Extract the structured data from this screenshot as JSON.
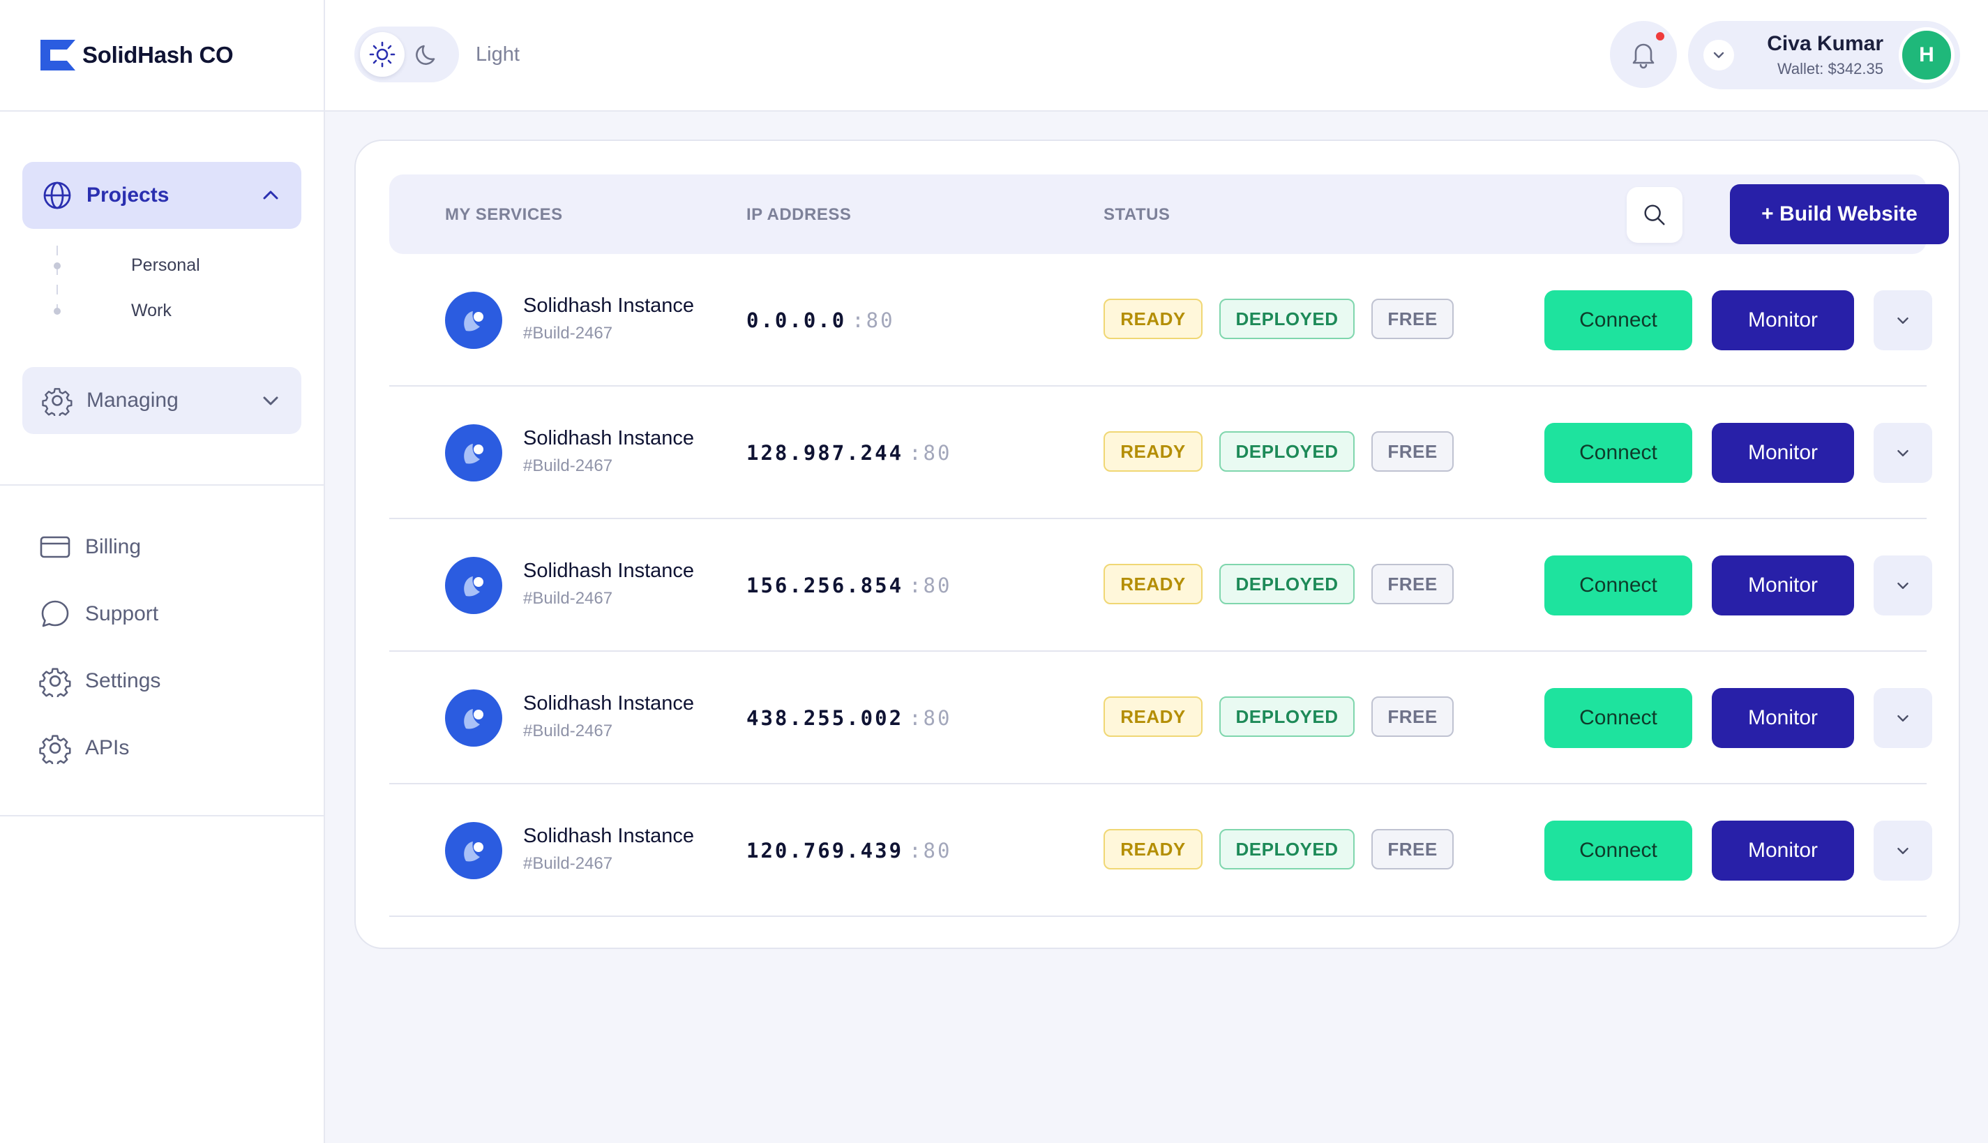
{
  "brand": {
    "name": "SolidHash CO"
  },
  "colors": {
    "primary": "#2820a8",
    "accent_green": "#1ee39e",
    "service_icon": "#2b5ce0",
    "notification_dot": "#ef3b3b",
    "avatar": "#1fb87a"
  },
  "sidebar": {
    "projects": {
      "label": "Projects",
      "icon": "globe-icon",
      "expanded": true,
      "children": [
        {
          "label": "Personal"
        },
        {
          "label": "Work"
        }
      ]
    },
    "managing": {
      "label": "Managing",
      "icon": "gear-icon",
      "expanded": false
    },
    "menu": [
      {
        "label": "Billing",
        "icon": "credit-card-icon"
      },
      {
        "label": "Support",
        "icon": "chat-bubble-icon"
      },
      {
        "label": "Settings",
        "icon": "gear-icon"
      },
      {
        "label": "APIs",
        "icon": "gear-icon"
      }
    ]
  },
  "topbar": {
    "theme_label": "Light",
    "theme_selected": "light",
    "has_notification": true,
    "user": {
      "name": "Civa Kumar",
      "wallet": "Wallet: $342.35",
      "avatar_initial": "H"
    }
  },
  "services": {
    "headers": {
      "service": "MY SERVICES",
      "ip": "IP ADDRESS",
      "status": "STATUS"
    },
    "build_button": "+ Build Website",
    "connect_label": "Connect",
    "monitor_label": "Monitor",
    "rows": [
      {
        "name": "Solidhash Instance",
        "build": "#Build-2467",
        "ip": "0.0.0.0",
        "port": ":80",
        "badges": [
          "READY",
          "DEPLOYED",
          "FREE"
        ]
      },
      {
        "name": "Solidhash Instance",
        "build": "#Build-2467",
        "ip": "128.987.244",
        "port": ":80",
        "badges": [
          "READY",
          "DEPLOYED",
          "FREE"
        ]
      },
      {
        "name": "Solidhash Instance",
        "build": "#Build-2467",
        "ip": "156.256.854",
        "port": ":80",
        "badges": [
          "READY",
          "DEPLOYED",
          "FREE"
        ]
      },
      {
        "name": "Solidhash Instance",
        "build": "#Build-2467",
        "ip": "438.255.002",
        "port": ":80",
        "badges": [
          "READY",
          "DEPLOYED",
          "FREE"
        ]
      },
      {
        "name": "Solidhash Instance",
        "build": "#Build-2467",
        "ip": "120.769.439",
        "port": ":80",
        "badges": [
          "READY",
          "DEPLOYED",
          "FREE"
        ]
      }
    ]
  }
}
